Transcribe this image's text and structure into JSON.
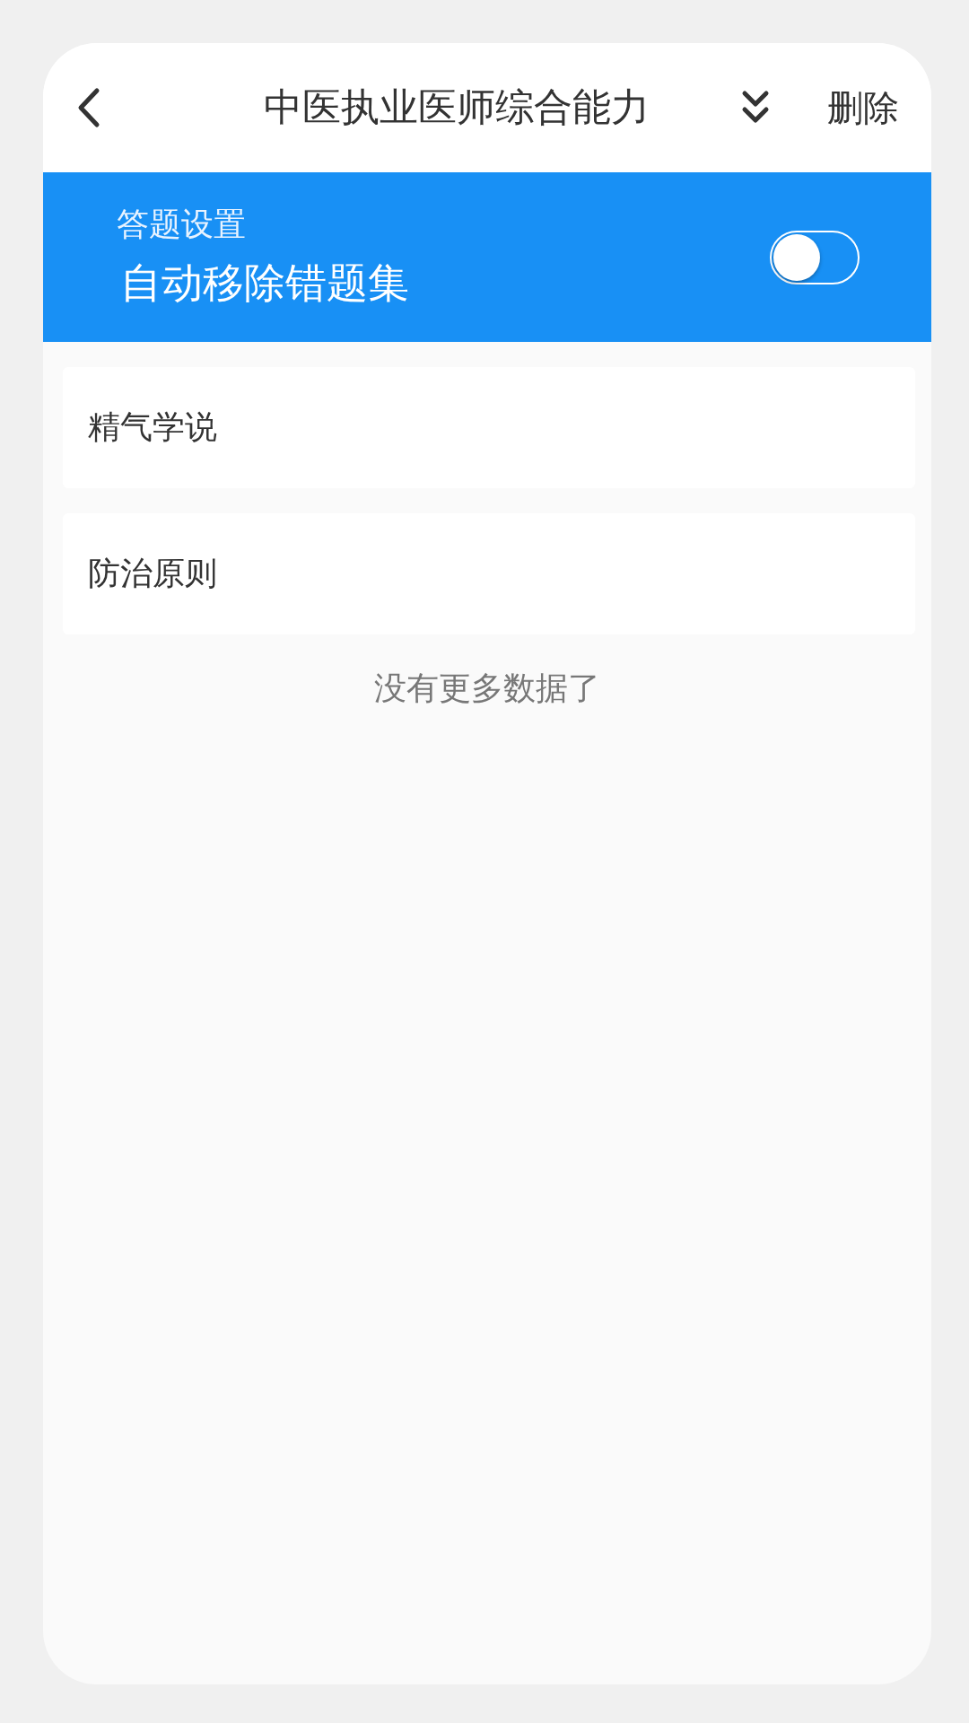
{
  "header": {
    "title": "中医执业医师综合能力",
    "action": "删除"
  },
  "settings": {
    "caption": "答题设置",
    "label": "自动移除错题集",
    "on": false
  },
  "items": [
    {
      "label": "精气学说"
    },
    {
      "label": "防治原则"
    }
  ],
  "footer": "没有更多数据了"
}
